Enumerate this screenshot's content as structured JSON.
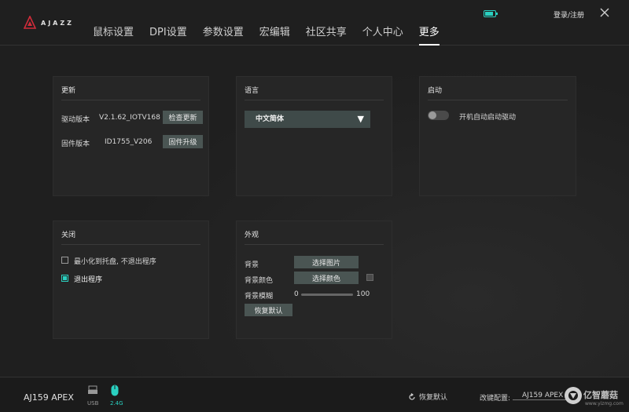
{
  "app": {
    "logo_text": "AJAZZ"
  },
  "header": {
    "nav": [
      "鼠标设置",
      "DPI设置",
      "参数设置",
      "宏编辑",
      "社区共享",
      "个人中心",
      "更多"
    ],
    "active_tab": "更多",
    "login_label": "登录/注册",
    "accent_color": "#2ad0c0"
  },
  "update_panel": {
    "title": "更新",
    "driver_label": "驱动版本",
    "driver_version": "V2.1.62_IOTV168",
    "check_update_button": "检查更新",
    "firmware_label": "固件版本",
    "firmware_version": "ID1755_V206",
    "firmware_upgrade_button": "固件升级"
  },
  "language_panel": {
    "title": "语言",
    "selected": "中文简体"
  },
  "startup_panel": {
    "title": "启动",
    "autostart_label": "开机自动启动驱动",
    "autostart_enabled": false
  },
  "close_panel": {
    "title": "关闭",
    "option_minimize": "最小化到托盘, 不退出程序",
    "option_exit": "退出程序",
    "selected": "退出程序"
  },
  "appearance_panel": {
    "title": "外观",
    "background_label": "背景",
    "select_image_button": "选择图片",
    "background_color_label": "背景颜色",
    "select_color_button": "选择颜色",
    "background_blur_label": "背景模糊",
    "blur_min": "0",
    "blur_max": "100",
    "restore_default_button": "恢复默认"
  },
  "footer": {
    "device_name": "AJ159 APEX",
    "usb_label": "USB",
    "wireless_label": "2.4G",
    "restore_default": "恢复默认",
    "change_config_label": "改键配置:",
    "config_value": "AJ159 APEX"
  },
  "watermark": {
    "text": "亿智蘑菇",
    "url": "www.yizmg.com"
  }
}
